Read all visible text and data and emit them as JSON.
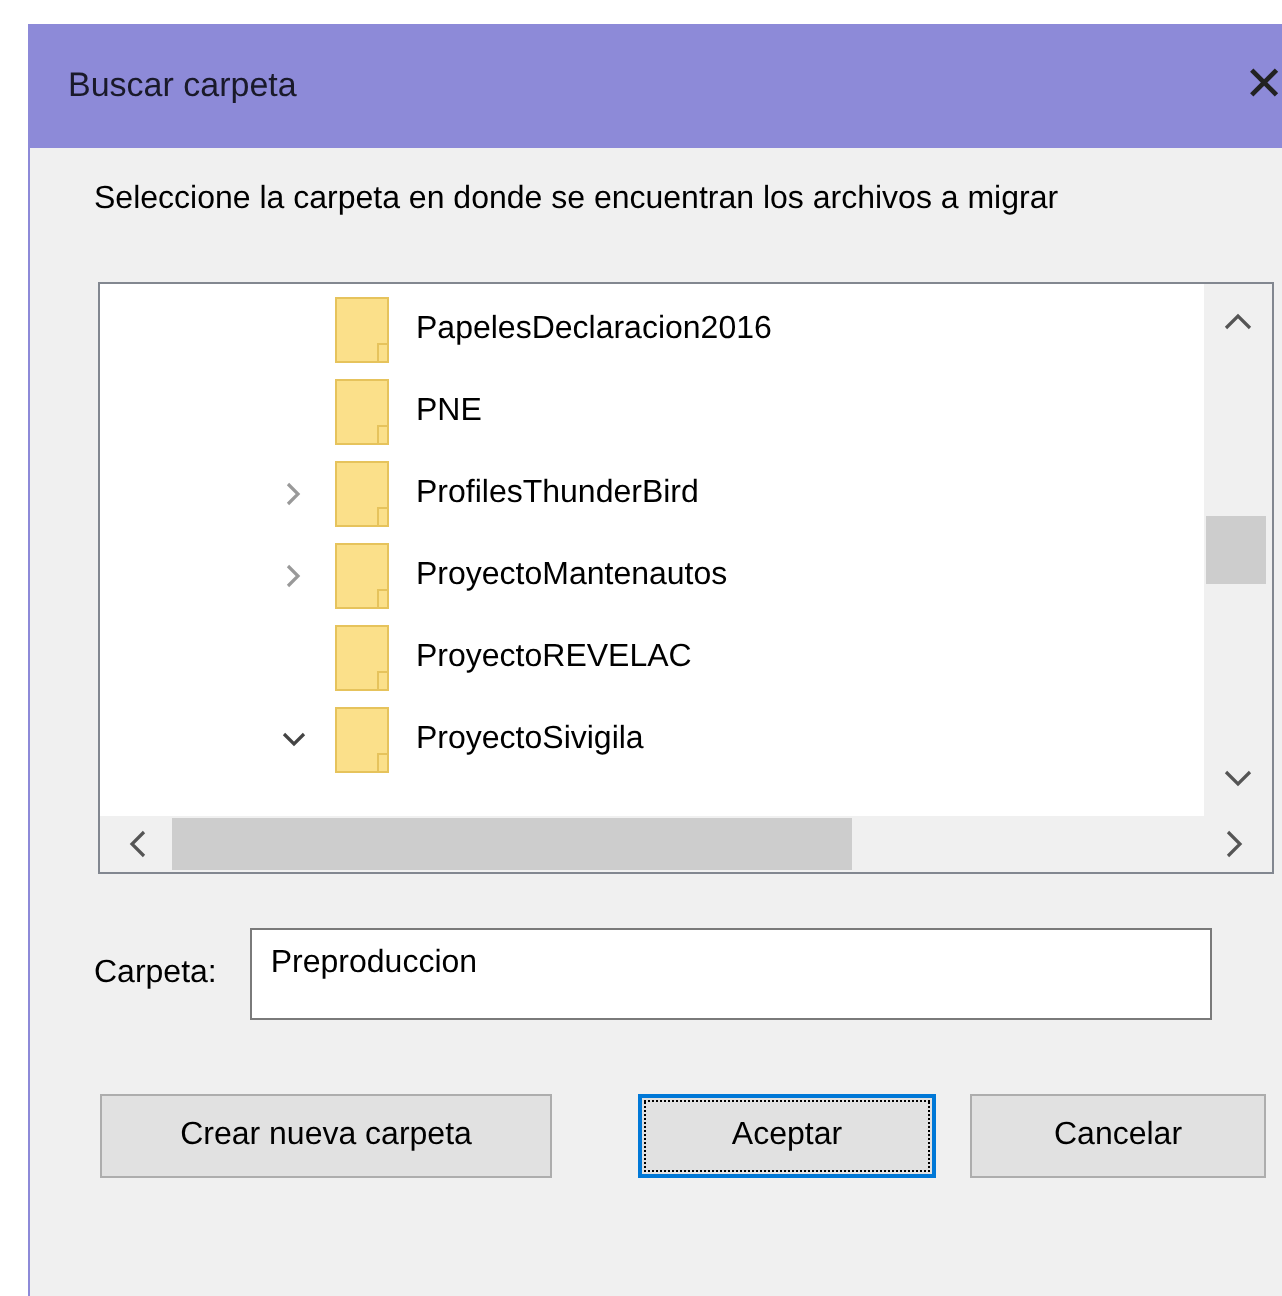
{
  "window": {
    "title": "Buscar carpeta",
    "close": "✕"
  },
  "instruction": "Seleccione la carpeta en donde se encuentran los archivos a migrar",
  "tree": {
    "items": [
      {
        "label": "PapelesDeclaracion2016",
        "kind": "leaf"
      },
      {
        "label": "PNE",
        "kind": "leaf"
      },
      {
        "label": "ProfilesThunderBird",
        "kind": "parent",
        "expanded": false
      },
      {
        "label": "ProyectoMantenautos",
        "kind": "parent",
        "expanded": false
      },
      {
        "label": "ProyectoREVELAC",
        "kind": "leaf"
      },
      {
        "label": "ProyectoSivigila",
        "kind": "parent",
        "expanded": true
      }
    ]
  },
  "folder_field": {
    "label": "Carpeta:",
    "value": "Preproduccion"
  },
  "buttons": [
    {
      "label": "Crear nueva carpeta",
      "default": false
    },
    {
      "label": "Aceptar",
      "default": true
    },
    {
      "label": "Cancelar",
      "default": false
    }
  ]
}
